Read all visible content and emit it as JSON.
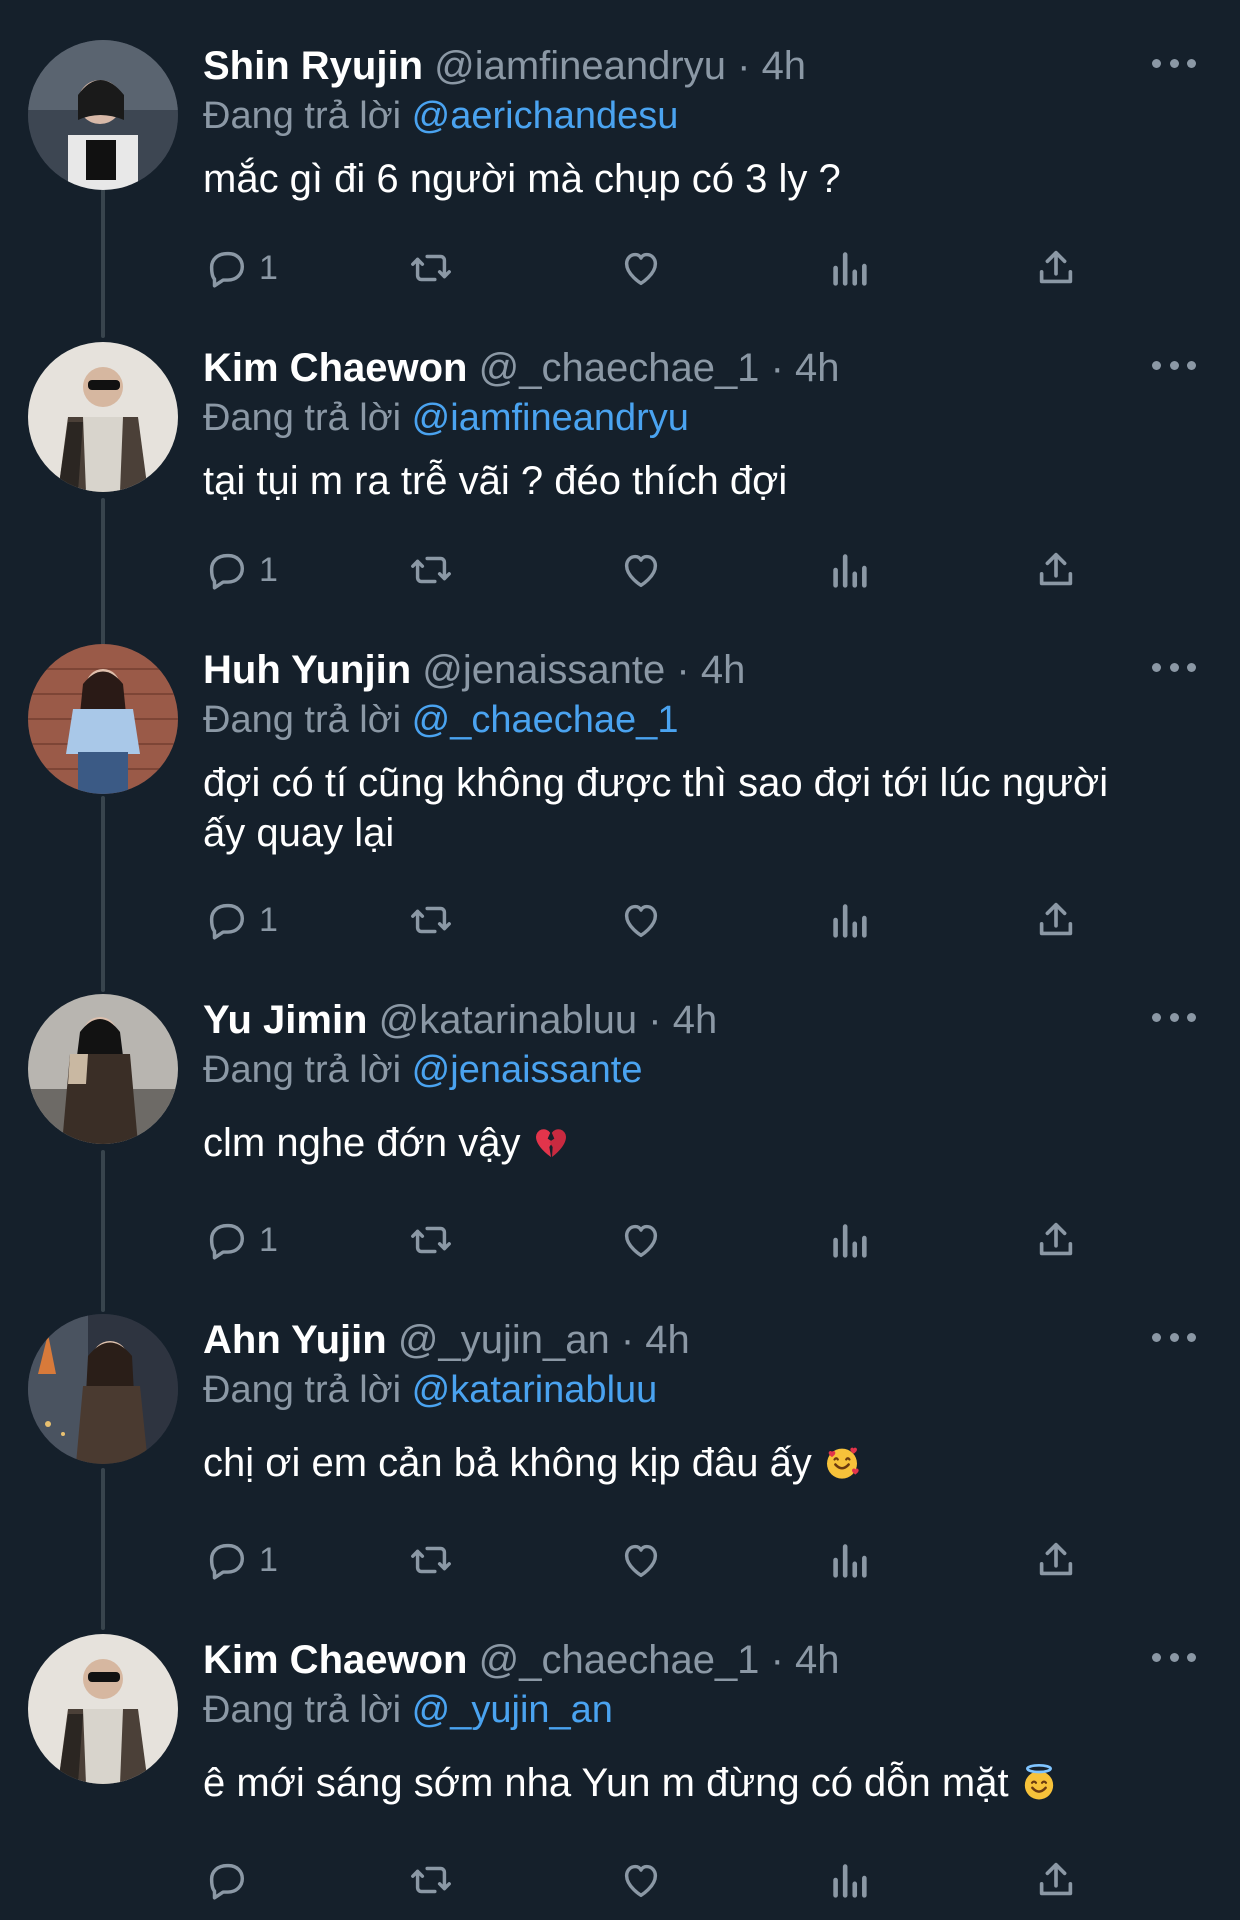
{
  "reply_prefix": "Đang trả lời",
  "tweets": [
    {
      "name": "Shin Ryujin",
      "handle": "@iamfineandryu",
      "time": "4h",
      "reply_to": "@aerichandesu",
      "text": "mắc gì đi 6 người mà chụp có 3 ly ?",
      "emoji": "",
      "reply_count": "1"
    },
    {
      "name": "Kim Chaewon",
      "handle": "@_chaechae_1",
      "time": "4h",
      "reply_to": "@iamfineandryu",
      "text": "tại tụi m ra trễ vãi ? đéo thích đợi",
      "emoji": "",
      "reply_count": "1"
    },
    {
      "name": "Huh Yunjin",
      "handle": "@jenaissante",
      "time": "4h",
      "reply_to": "@_chaechae_1",
      "text_line1": "đợi có tí cũng không được thì sao đợi tới lúc người",
      "text_line2": "ấy quay lại",
      "emoji": "",
      "reply_count": "1"
    },
    {
      "name": "Yu Jimin",
      "handle": "@katarinabluu",
      "time": "4h",
      "reply_to": "@jenaissante",
      "text": "clm nghe đớn vậy",
      "emoji": "broken-heart",
      "reply_count": "1"
    },
    {
      "name": "Ahn Yujin",
      "handle": "@_yujin_an",
      "time": "4h",
      "reply_to": "@katarinabluu",
      "text": "chị ơi em cản bả không kịp đâu ấy",
      "emoji": "smiling-face-with-hearts",
      "reply_count": "1"
    },
    {
      "name": "Kim Chaewon",
      "handle": "@_chaechae_1",
      "time": "4h",
      "reply_to": "@_yujin_an",
      "text": "ê mới sáng sớm nha Yun m đừng có dỗn mặt",
      "emoji": "smiling-face-with-halo",
      "reply_count": ""
    }
  ],
  "icons": {
    "reply": "reply-icon",
    "retweet": "retweet-icon",
    "like": "heart-icon",
    "views": "views-icon",
    "share": "share-icon",
    "more": "more-icon"
  },
  "colors": {
    "background": "#15202b",
    "text": "#ffffff",
    "secondary": "#8b98a5",
    "mention": "#4aa3f0"
  }
}
